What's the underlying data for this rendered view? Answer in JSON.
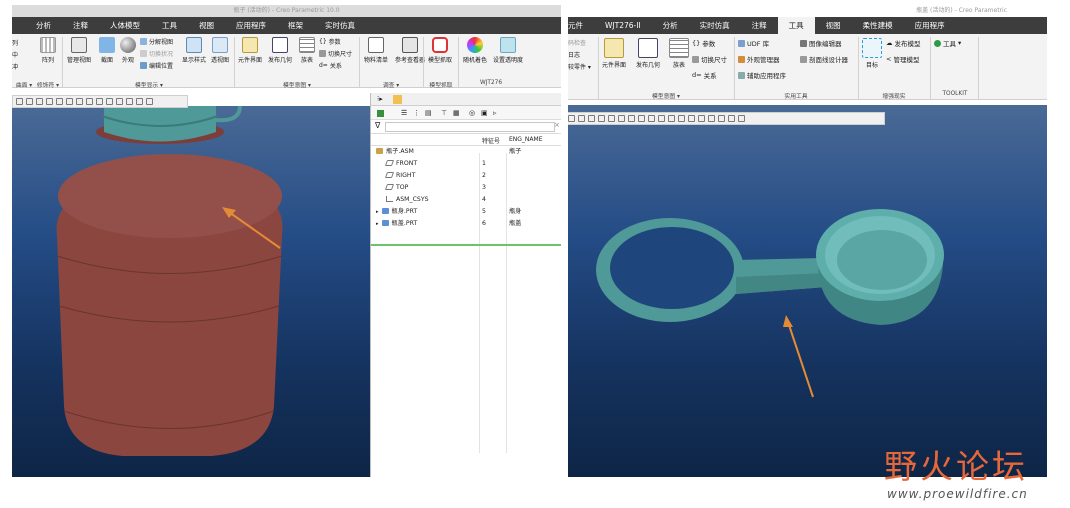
{
  "left_window": {
    "title": "瓶子 (活动的) - Creo Parametric 10.0",
    "menu_tabs": [
      "分析",
      "注释",
      "人体模型",
      "工具",
      "视图",
      "应用程序",
      "框架",
      "实时仿真"
    ],
    "ribbon": {
      "partial_left": [
        "列",
        "中",
        "冲"
      ],
      "array": "阵列",
      "manage_view": "管理视图",
      "section": "截面",
      "appearance": "外观",
      "exploded_view": "分解视图",
      "toggle_state": "切换状况",
      "edit_position": "编辑位置",
      "display_style": "显示样式",
      "perspective": "透视图",
      "component_interface": "元件界面",
      "publish_geometry": "发布几何",
      "table": "族表",
      "params": "参数",
      "switch_dims": "切换尺寸",
      "relations": "关系",
      "bom": "物料清单",
      "reference_viewer": "参考查看器",
      "model_capture": "模型抓取",
      "random_color": "随机着色",
      "set_transparency": "设置透明度",
      "groups": [
        "修饰符 ▾",
        "模型显示 ▾",
        "模型意图 ▾",
        "调查 ▾",
        "模型抓取",
        "WJT276"
      ],
      "partial_group": "曲面 ▾"
    },
    "model_tree": {
      "col_feature_id": "特征号",
      "col_eng_name": "ENG_NAME",
      "rows": [
        {
          "name": "瓶子.ASM",
          "id": "",
          "eng": "瓶子",
          "icon": "asm"
        },
        {
          "name": "FRONT",
          "id": "1",
          "eng": "",
          "icon": "plane"
        },
        {
          "name": "RIGHT",
          "id": "2",
          "eng": "",
          "icon": "plane"
        },
        {
          "name": "TOP",
          "id": "3",
          "eng": "",
          "icon": "plane"
        },
        {
          "name": "ASM_CSYS",
          "id": "4",
          "eng": "",
          "icon": "csys"
        },
        {
          "name": "瓶身.PRT",
          "id": "5",
          "eng": "瓶身",
          "icon": "prt"
        },
        {
          "name": "瓶盖.PRT",
          "id": "6",
          "eng": "瓶盖",
          "icon": "prt"
        }
      ]
    }
  },
  "right_window": {
    "title": "瓶盖 (活动的) - Creo Parametric",
    "menu_tabs": [
      "元件",
      "WJT276-II",
      "分析",
      "实时仿真",
      "注释",
      "工具",
      "视图",
      "柔性建模",
      "应用程序"
    ],
    "active_tab": "工具",
    "ribbon": {
      "partial_left": [
        "码检查",
        "日志",
        "较零件 ▾"
      ],
      "component_interface": "元件界面",
      "publish_geometry": "发布几何",
      "table": "族表",
      "params": "参数",
      "switch_dims": "切换尺寸",
      "relations": "关系",
      "udf_lib": "UDF 库",
      "appearance_manager": "外观管理器",
      "aux_app": "辅助应用程序",
      "image_editor": "图像编辑器",
      "section_designer": "剖面线设计器",
      "target": "目标",
      "publish_model": "发布模型",
      "manage_model": "管理模型",
      "tools": "工具",
      "groups": [
        "模型意图 ▾",
        "实用工具",
        "增强现实",
        "TOOLKIT"
      ]
    }
  },
  "watermark": {
    "title": "野火论坛",
    "url": "www.proewildfire.cn"
  },
  "colors": {
    "bottle_body": "#8b4640",
    "bottle_cap": "#4f9a98",
    "viewport_top": "#4a6a96",
    "viewport_bottom": "#0e2546",
    "arrow": "#e58a35",
    "active_tab_bg": "#f3f3f3",
    "menu_bg": "#3d3d3d"
  }
}
